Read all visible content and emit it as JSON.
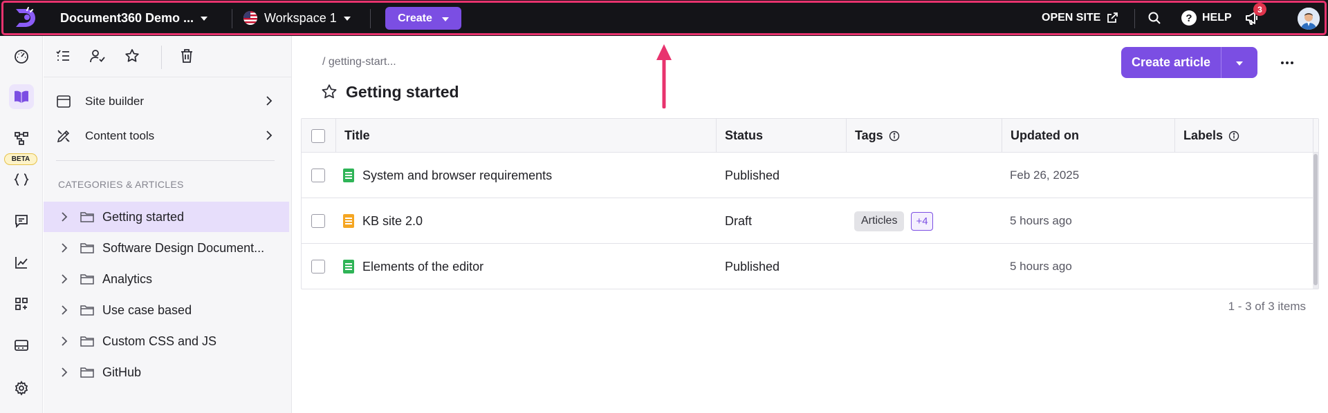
{
  "topbar": {
    "project_name": "Document360 Demo ...",
    "workspace_name": "Workspace 1",
    "create_label": "Create",
    "open_site_label": "OPEN SITE",
    "help_label": "HELP",
    "help_glyph": "?",
    "notification_count": "3",
    "highlight_color": "#e8336e",
    "accent_color": "#7b4ee3"
  },
  "rail": {
    "items": [
      "dashboard-icon",
      "documentation-icon",
      "workflow-icon",
      "api-icon",
      "feedback-icon",
      "analytics-icon",
      "apps-icon",
      "widgets-icon",
      "settings-icon"
    ],
    "beta_label": "BETA",
    "active": "documentation-icon"
  },
  "sidebar": {
    "tools": [
      "all-articles-icon",
      "my-articles-icon",
      "starred-icon",
      "recycle-bin-icon"
    ],
    "links": [
      {
        "label": "Site builder",
        "icon": "browser-icon"
      },
      {
        "label": "Content tools",
        "icon": "pencil-ruler-icon"
      }
    ],
    "categories_heading": "CATEGORIES & ARTICLES",
    "categories": [
      {
        "label": "Getting started",
        "selected": true
      },
      {
        "label": "Software Design Document..."
      },
      {
        "label": "Analytics"
      },
      {
        "label": "Use case based"
      },
      {
        "label": "Custom CSS and JS"
      },
      {
        "label": "GitHub"
      }
    ]
  },
  "main": {
    "breadcrumb": "/ getting-start...",
    "title": "Getting started",
    "create_article_label": "Create article",
    "columns": [
      "Title",
      "Status",
      "Tags",
      "Updated on",
      "Labels"
    ],
    "rows": [
      {
        "title": "System and browser requirements",
        "status": "Published",
        "tags": [],
        "tags_more": "",
        "updated": "Feb 26, 2025",
        "doc_color": "#2fb457"
      },
      {
        "title": "KB site 2.0",
        "status": "Draft",
        "tags": [
          "Articles"
        ],
        "tags_more": "+4",
        "updated": "5 hours ago",
        "doc_color": "#f5a623"
      },
      {
        "title": "Elements of the editor",
        "status": "Published",
        "tags": [],
        "tags_more": "",
        "updated": "5 hours ago",
        "doc_color": "#2fb457"
      }
    ],
    "pager": "1 - 3 of 3 items"
  }
}
